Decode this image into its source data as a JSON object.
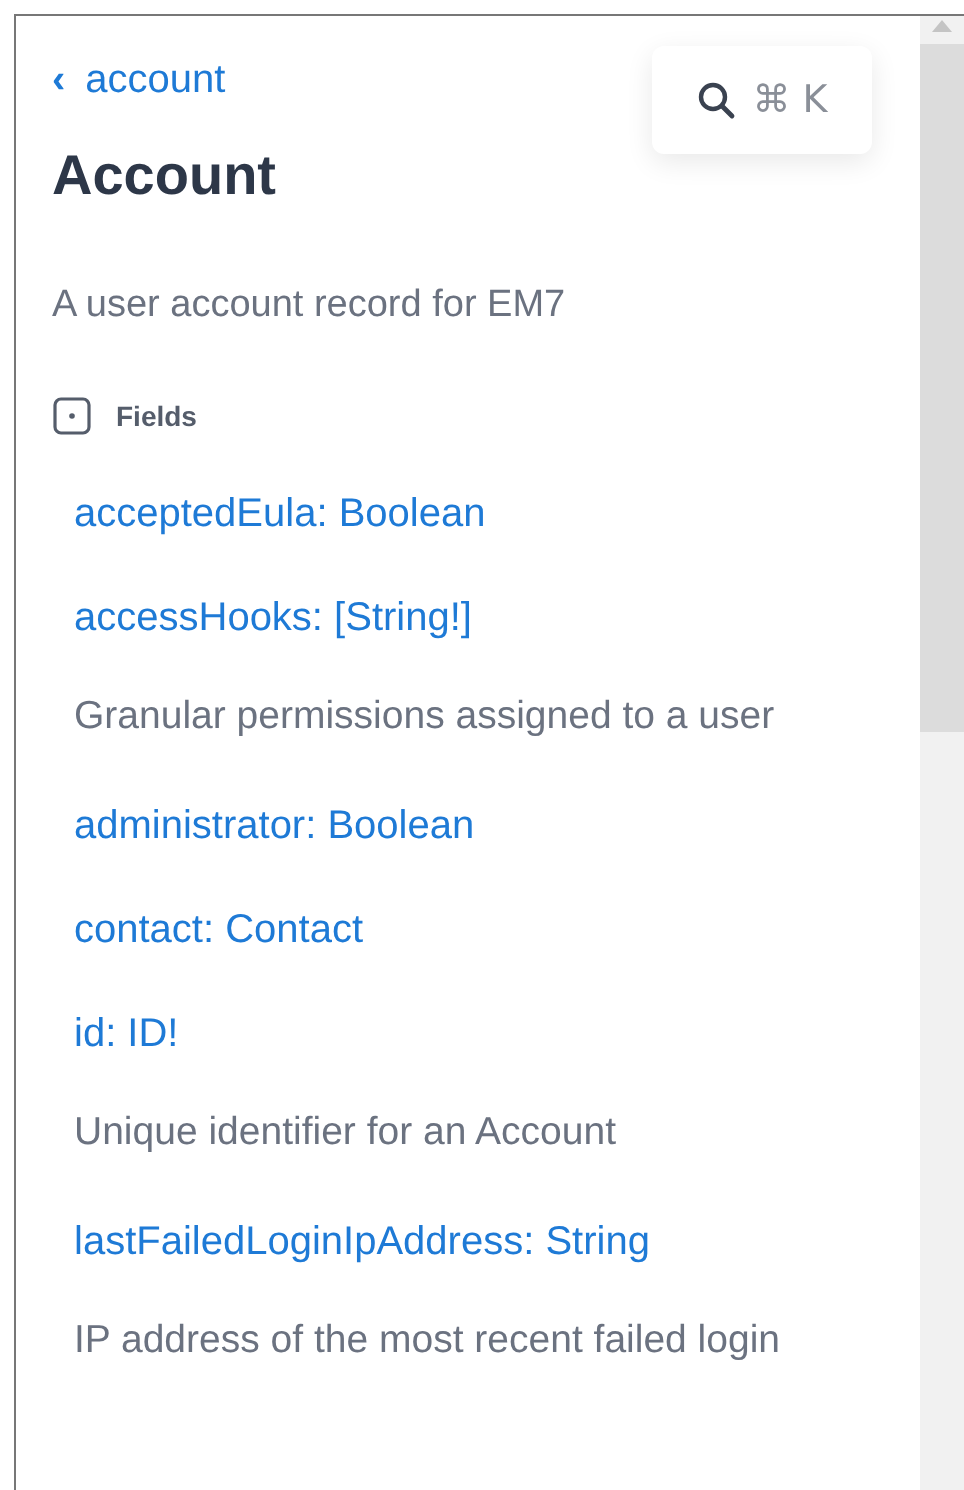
{
  "breadcrumb": {
    "icon": "‹",
    "label": "account"
  },
  "search": {
    "shortcut": "⌘ K"
  },
  "title": "Account",
  "description": "A user account record for EM7",
  "section": {
    "label": "Fields"
  },
  "fields": [
    {
      "signature": "acceptedEula: Boolean"
    },
    {
      "signature": "accessHooks: [String!]",
      "description": "Granular permissions assigned to a user"
    },
    {
      "signature": "administrator: Boolean"
    },
    {
      "signature": "contact: Contact"
    },
    {
      "signature": "id: ID!",
      "description": "Unique identifier for an Account"
    },
    {
      "signature": "lastFailedLoginIpAddress: String",
      "description": "IP address of the most recent failed login"
    }
  ]
}
